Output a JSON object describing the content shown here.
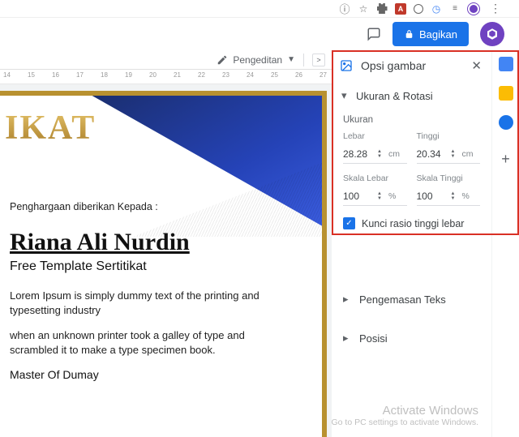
{
  "browser_ext": {
    "a_badge": "A"
  },
  "docs": {
    "share_label": "Bagikan",
    "mode_label": "Pengeditan"
  },
  "ruler": {
    "labels": [
      "14",
      "15",
      "16",
      "17",
      "18",
      "19",
      "20",
      "21",
      "22",
      "23",
      "24",
      "25",
      "26",
      "27"
    ]
  },
  "certificate": {
    "partial_title": "IKAT",
    "given_to": "Penghargaan diberikan Kepada :",
    "name": "Riana Ali Nurdin",
    "subtitle": "Free Template Sertitikat",
    "para1": "Lorem Ipsum is simply dummy text of the printing and typesetting industry",
    "para2": "when an unknown printer took a galley of type and scrambled it to make a type specimen book.",
    "signer": "Master Of Dumay"
  },
  "panel": {
    "title": "Opsi gambar",
    "section_size": "Ukuran & Rotasi",
    "size_label": "Ukuran",
    "width_label": "Lebar",
    "height_label": "Tinggi",
    "width_value": "28.28",
    "height_value": "20.34",
    "unit_cm": "cm",
    "scale_w_label": "Skala Lebar",
    "scale_h_label": "Skala Tinggi",
    "scale_w_value": "100",
    "scale_h_value": "100",
    "unit_pct": "%",
    "lock_ratio": "Kunci rasio tinggi lebar",
    "section_text": "Pengemasan Teks",
    "section_pos": "Posisi"
  },
  "watermark": {
    "line1": "Activate Windows",
    "line2": "Go to PC settings to activate Windows."
  }
}
